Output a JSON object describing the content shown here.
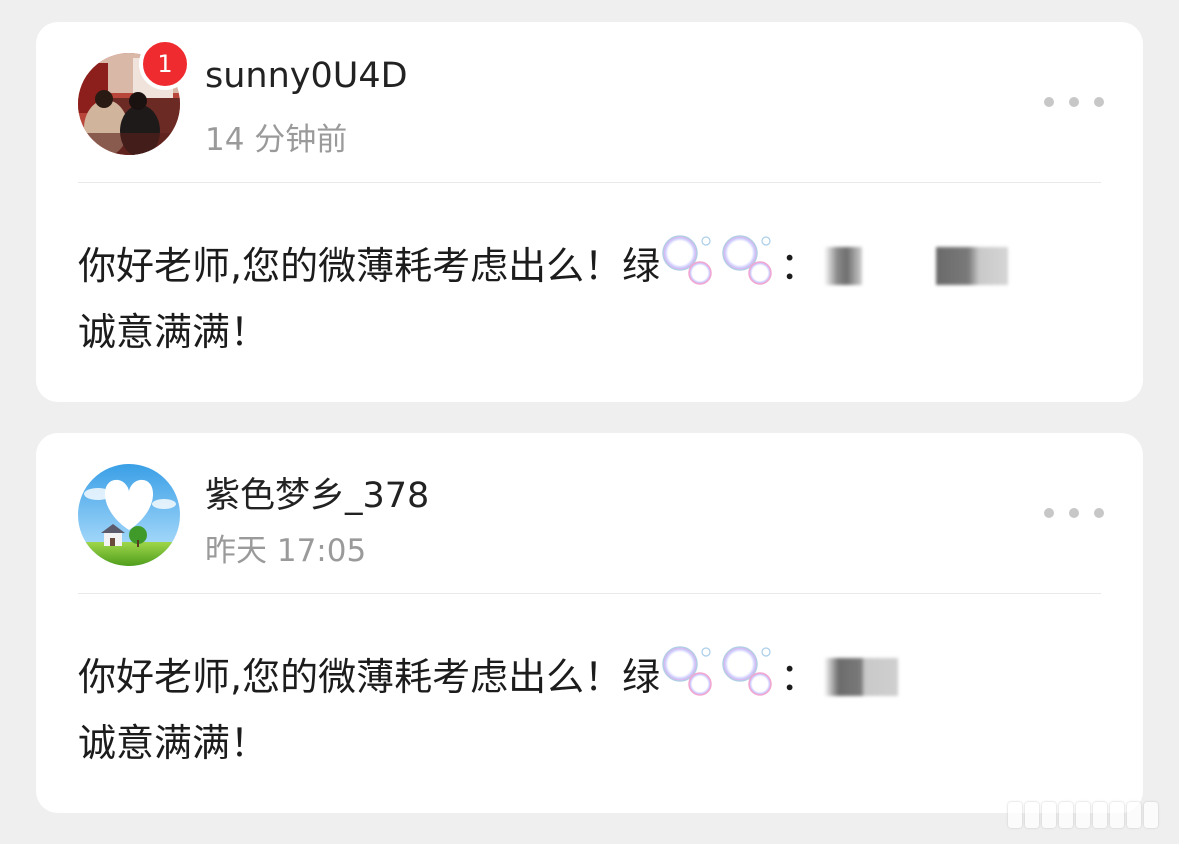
{
  "notifications": [
    {
      "username": "sunny0U4D",
      "timestamp": "14 分钟前",
      "unread_badge": "1",
      "avatar": "photo-avatar-couple",
      "message_line1_prefix": "你好老师,您的微薄耗考虑出么！绿",
      "message_line1_colon": "：",
      "message_line2": "诚意满满！"
    },
    {
      "username": "紫色梦乡_378",
      "timestamp": "昨天 17:05",
      "avatar": "landscape-avatar-heart-cloud",
      "message_line1_prefix": "你好老师,您的微薄耗考虑出么！绿",
      "message_line1_colon": "：",
      "message_line2": "诚意满满！"
    }
  ],
  "icons": {
    "more": "more-dots-icon",
    "bubble": "bubble-emoji-icon",
    "redacted": "blurred-text-redaction"
  },
  "colors": {
    "badge": "#ef2b30",
    "background": "#efefef",
    "card": "#ffffff",
    "secondary_text": "#9a9a9a",
    "primary_text": "#1c1c1c"
  }
}
